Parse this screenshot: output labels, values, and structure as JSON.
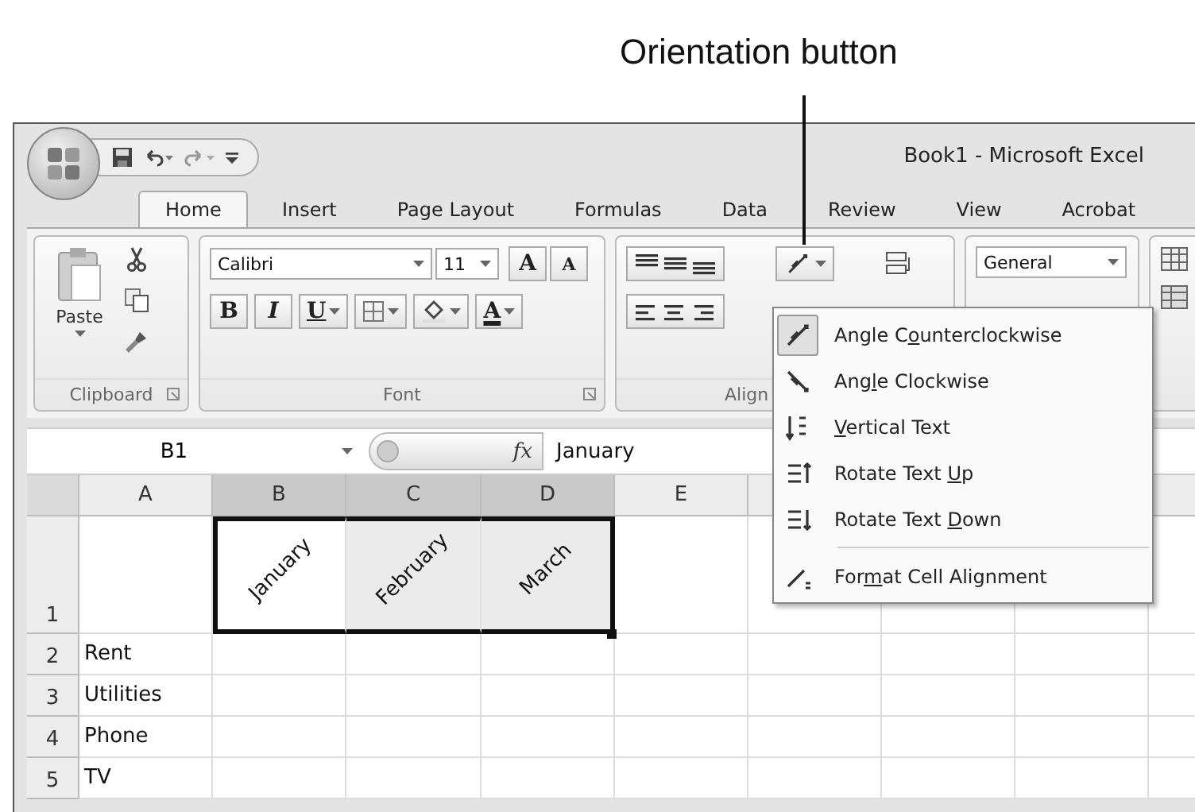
{
  "callout": {
    "label": "Orientation button"
  },
  "window": {
    "title": "Book1 - Microsoft Excel"
  },
  "tabs": [
    {
      "label": "Home",
      "selected": true
    },
    {
      "label": "Insert",
      "selected": false
    },
    {
      "label": "Page Layout",
      "selected": false
    },
    {
      "label": "Formulas",
      "selected": false
    },
    {
      "label": "Data",
      "selected": false
    },
    {
      "label": "Review",
      "selected": false
    },
    {
      "label": "View",
      "selected": false
    },
    {
      "label": "Acrobat",
      "selected": false
    }
  ],
  "ribbon": {
    "clipboard": {
      "label": "Clipboard",
      "paste": "Paste"
    },
    "font": {
      "label": "Font",
      "font_name": "Calibri",
      "font_size": "11",
      "grow": "A",
      "shrink": "A",
      "bold": "B",
      "italic": "I",
      "underline": "U",
      "font_color": "A"
    },
    "alignment": {
      "label": "Align"
    },
    "number": {
      "format": "General"
    }
  },
  "formula_bar": {
    "name_box": "B1",
    "fx": "fx",
    "formula": "January"
  },
  "sheet": {
    "columns": [
      {
        "label": "A",
        "selected": false
      },
      {
        "label": "B",
        "selected": true
      },
      {
        "label": "C",
        "selected": true
      },
      {
        "label": "D",
        "selected": true
      },
      {
        "label": "E",
        "selected": false
      }
    ],
    "rows": [
      {
        "kind": "header",
        "number": "1",
        "cells": [
          {
            "text": "January",
            "active": true
          },
          {
            "text": "February",
            "active": false
          },
          {
            "text": "March",
            "active": false
          }
        ]
      },
      {
        "kind": "item",
        "number": "2",
        "label": "Rent"
      },
      {
        "kind": "item",
        "number": "3",
        "label": "Utilities"
      },
      {
        "kind": "item",
        "number": "4",
        "label": "Phone"
      },
      {
        "kind": "item",
        "number": "5",
        "label": "TV"
      }
    ]
  },
  "orientation_menu": {
    "items": [
      {
        "kind": "command",
        "before": "Angle C",
        "key": "o",
        "after": "unterclockwise",
        "selected": true
      },
      {
        "kind": "command",
        "before": "Ang",
        "key": "l",
        "after": "e Clockwise",
        "selected": false
      },
      {
        "kind": "command",
        "key": "V",
        "after": "ertical Text",
        "selected": false
      },
      {
        "kind": "command",
        "before": "Rotate Text ",
        "key": "U",
        "after": "p",
        "selected": false
      },
      {
        "kind": "command",
        "before": "Rotate Text ",
        "key": "D",
        "after": "own",
        "selected": false
      },
      {
        "kind": "separator"
      },
      {
        "kind": "command",
        "before": "For",
        "key": "m",
        "after": "at Cell Alignment",
        "selected": false
      }
    ]
  }
}
